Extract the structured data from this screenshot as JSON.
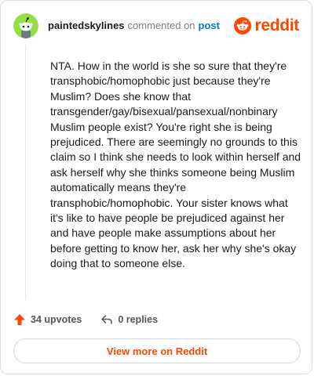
{
  "comment": {
    "author": "paintedskylines",
    "action_text": "commented on",
    "post_link": "post",
    "body": "NTA. How in the world is she so sure that they're transphobic/homophobic just because they're Muslim? Does she know that transgender/gay/bisexual/pansexual/nonbinary Muslim people exist? You're right she is being prejudiced. There are seemingly no grounds to this claim so I think she needs to look within herself and ask herself why she thinks someone being Muslim automatically means they're transphobic/homophobic. Your sister knows what it's like to have people be prejudiced against her and have people make assumptions about her before getting to know her, ask her why she's okay doing that to someone else.",
    "upvotes": "34 upvotes",
    "replies": "0 replies"
  },
  "brand": {
    "name": "reddit",
    "color": "#ff4500"
  },
  "footer": {
    "view_more_label": "View more on Reddit"
  },
  "icons": {
    "avatar": "snoo-avatar-icon",
    "logo": "reddit-logo-icon",
    "upvote": "upvote-arrow-icon",
    "reply": "reply-arrow-icon"
  },
  "colors": {
    "accent": "#ff4500",
    "link": "#0079d3",
    "avatar_bg": "#94e044"
  }
}
